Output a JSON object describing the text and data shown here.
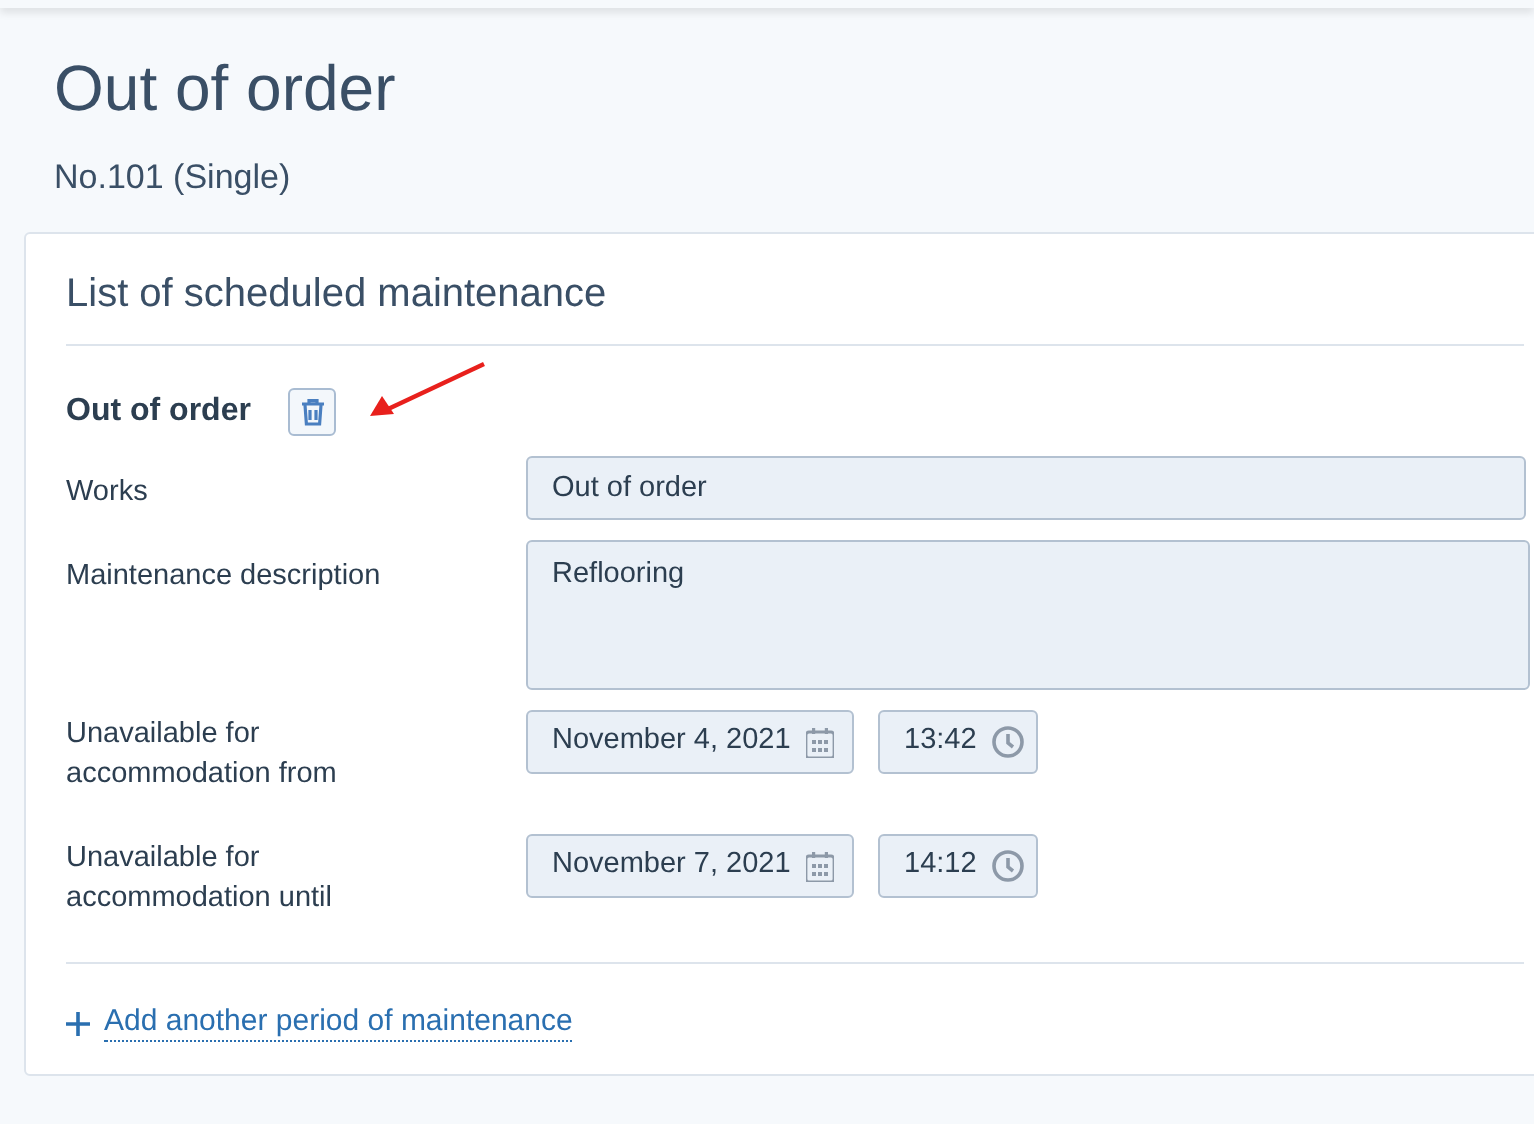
{
  "page": {
    "title": "Out of order",
    "subtitle": "No.101 (Single)"
  },
  "card": {
    "title": "List of scheduled maintenance",
    "entry": {
      "title": "Out of order",
      "fields": [
        {
          "kind": "text",
          "label": "Works",
          "value": "Out of order"
        },
        {
          "kind": "textarea",
          "label": "Maintenance description",
          "value": "Reflooring"
        },
        {
          "kind": "datetime",
          "label": "Unavailable for accommodation from",
          "date": "November 4, 2021",
          "time": "13:42"
        },
        {
          "kind": "datetime",
          "label": "Unavailable for accommodation until",
          "date": "November 7, 2021",
          "time": "14:12"
        }
      ]
    },
    "add_link": "Add another period of maintenance"
  }
}
